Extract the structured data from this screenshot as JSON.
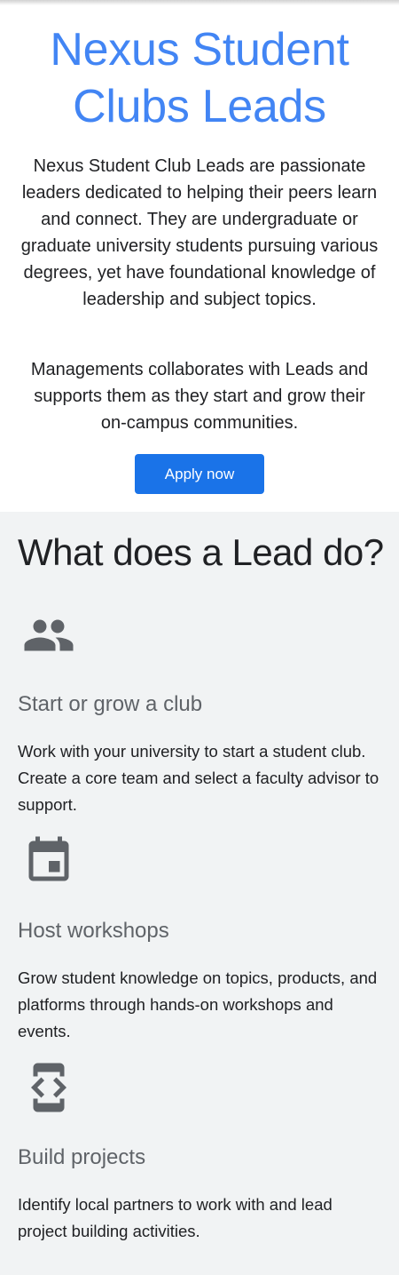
{
  "hero": {
    "title": "Nexus Student Clubs Leads",
    "paragraph_1": "Nexus Student Club Leads are passionate leaders dedicated to helping their peers learn and connect. They are undergraduate or graduate university students pursuing various degrees, yet have foundational knowledge of leadership and subject topics.",
    "paragraph_2": "Managements collaborates with Leads and supports them as they start and grow their on-campus communities.",
    "apply_label": "Apply now"
  },
  "section": {
    "heading": "What does a Lead do?",
    "features": [
      {
        "icon": "people-icon",
        "title": "Start or grow a club",
        "description": "Work with your university to start a student club. Create a core team and select a faculty advisor to support."
      },
      {
        "icon": "calendar-icon",
        "title": "Host workshops",
        "description": "Grow student knowledge on topics, products, and platforms through hands-on workshops and events."
      },
      {
        "icon": "developer-mode-icon",
        "title": "Build projects",
        "description": "Identify local partners to work with and lead project building activities."
      }
    ]
  },
  "colors": {
    "title_blue": "#4285f4",
    "button_blue": "#1a73e8",
    "section_bg": "#f1f3f4",
    "icon_gray": "#5f6368"
  }
}
